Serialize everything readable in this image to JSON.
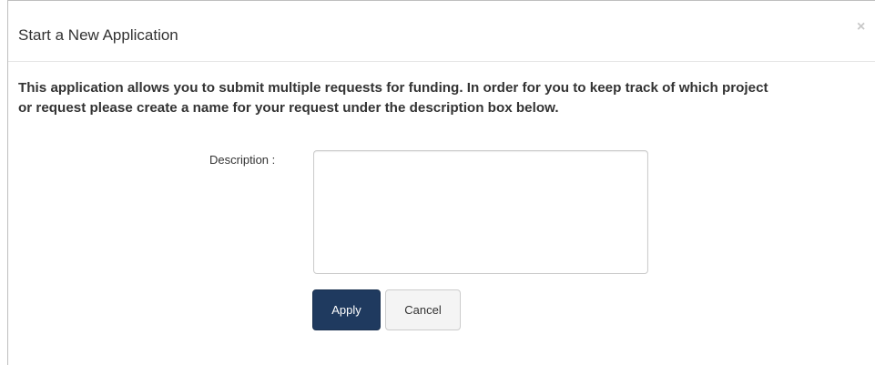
{
  "modal": {
    "title": "Start a New Application",
    "close_label": "×",
    "intro_line1": "This application allows you to submit multiple requests for funding. In order for you to keep track of which project",
    "intro_line2": "or request please create a name for your request under the description box below.",
    "description_label": "Description :",
    "description_value": "",
    "apply_label": "Apply",
    "cancel_label": "Cancel"
  },
  "colors": {
    "apply_bg": "#1f3a5f",
    "cancel_bg": "#f4f4f4",
    "text": "#333333"
  }
}
